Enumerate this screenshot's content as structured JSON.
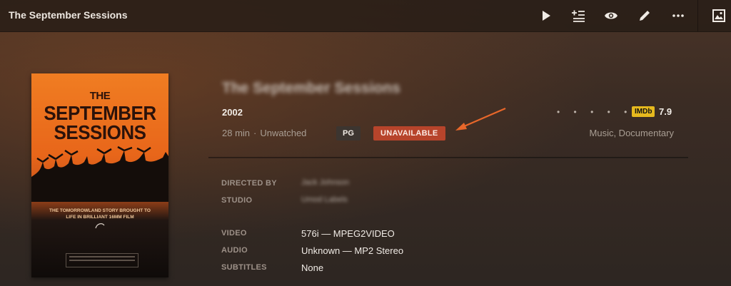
{
  "window": {
    "title": "The September Sessions"
  },
  "toolbar": {
    "icons": [
      "play-icon",
      "add-to-queue-icon",
      "eye-icon",
      "edit-pencil-icon",
      "more-dots-icon",
      "image-icon"
    ]
  },
  "poster": {
    "title_top": "THE",
    "title_main": "SEPTEMBER\nSESSIONS",
    "tagline": "THE TOMORROWLAND STORY BROUGHT TO LIFE IN BRILLIANT 16MM FILM"
  },
  "movie": {
    "title": "The September Sessions",
    "year": "2002",
    "duration": "28 min",
    "separator": "·",
    "watch_status": "Unwatched",
    "content_rating": "PG",
    "availability": "UNAVAILABLE",
    "genres": "Music, Documentary",
    "rating_dots": "• • • • •",
    "imdb_label": "IMDb",
    "imdb_score": "7.9"
  },
  "credits": {
    "directed_by_label": "DIRECTED BY",
    "directed_by_value": "Jack Johnson",
    "studio_label": "STUDIO",
    "studio_value": "Umod Labels"
  },
  "media": {
    "video_label": "VIDEO",
    "video_value": "576i — MPEG2VIDEO",
    "audio_label": "AUDIO",
    "audio_value": "Unknown — MP2 Stereo",
    "subtitles_label": "SUBTITLES",
    "subtitles_value": "None"
  },
  "colors": {
    "unavailable_badge": "#b7442b",
    "imdb_badge": "#e6b91e",
    "annotation_arrow": "#e8672a"
  }
}
